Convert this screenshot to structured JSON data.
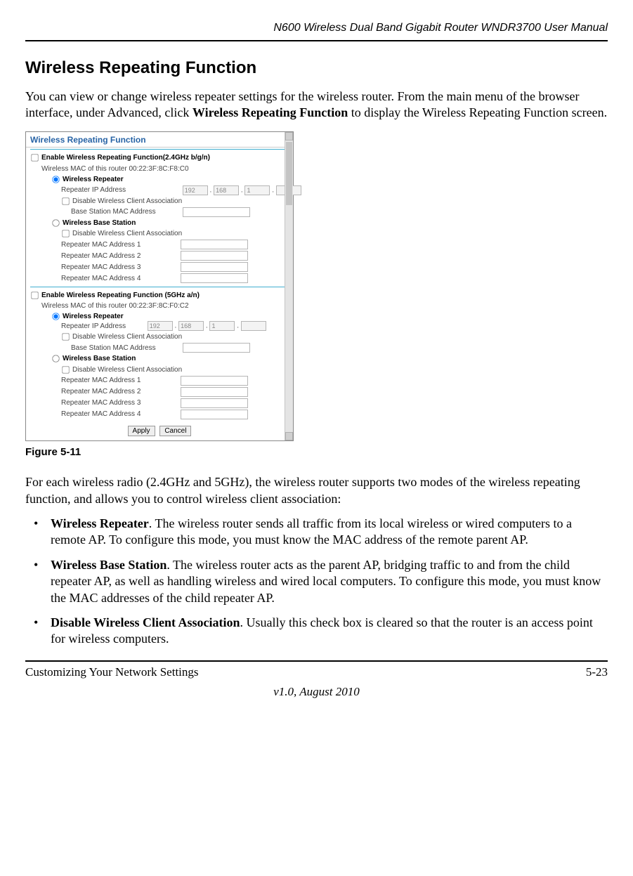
{
  "header": {
    "title": "N600 Wireless Dual Band Gigabit Router WNDR3700 User Manual"
  },
  "section": {
    "title": "Wireless Repeating Function",
    "intro_before_bold": "You can view or change wireless repeater settings for the wireless router. From the main menu of the browser interface, under Advanced, click ",
    "intro_bold": "Wireless Repeating Function",
    "intro_after_bold": " to display the Wireless Repeating Function screen."
  },
  "figure": {
    "title": "Wireless Repeating Function",
    "caption": "Figure 5-11",
    "band24": {
      "enable_label": "Enable Wireless Repeating Function(2.4GHz b/g/n)",
      "mac_label": "Wireless MAC of this router 00:22:3F:8C:F8:C0",
      "repeater_option": "Wireless Repeater",
      "repeater_ip_label": "Repeater IP Address",
      "ip": [
        "192",
        "168",
        "1",
        ""
      ],
      "disable_assoc": "Disable Wireless Client Association",
      "base_mac_label": "Base Station MAC Address",
      "base_option": "Wireless Base Station",
      "rep_mac1": "Repeater MAC Address 1",
      "rep_mac2": "Repeater MAC Address 2",
      "rep_mac3": "Repeater MAC Address 3",
      "rep_mac4": "Repeater MAC Address 4"
    },
    "band5": {
      "enable_label": "Enable Wireless Repeating Function (5GHz a/n)",
      "mac_label": "Wireless MAC of this router 00:22:3F:8C:F0:C2",
      "repeater_option": "Wireless Repeater",
      "repeater_ip_label": "Repeater IP Address",
      "ip": [
        "192",
        "168",
        "1",
        ""
      ],
      "disable_assoc": "Disable Wireless Client Association",
      "base_mac_label": "Base Station MAC Address",
      "base_option": "Wireless Base Station",
      "rep_mac1": "Repeater MAC Address 1",
      "rep_mac2": "Repeater MAC Address 2",
      "rep_mac3": "Repeater MAC Address 3",
      "rep_mac4": "Repeater MAC Address 4"
    },
    "buttons": {
      "apply": "Apply",
      "cancel": "Cancel"
    }
  },
  "body": {
    "para1": "For each wireless radio (2.4GHz and 5GHz), the wireless router supports two modes of the wireless repeating function, and allows you to control wireless client association:",
    "bullets": [
      {
        "bold": "Wireless Repeater",
        "text": ". The wireless router sends all traffic from its local wireless or wired computers to a remote AP. To configure this mode, you must know the MAC address of the remote parent AP."
      },
      {
        "bold": "Wireless Base Station",
        "text": ". The wireless router acts as the parent AP, bridging traffic to and from the child repeater AP, as well as handling wireless and wired local computers. To configure this mode, you must know the MAC addresses of the child repeater AP."
      },
      {
        "bold": "Disable Wireless Client Association",
        "text": ". Usually this check box is cleared so that the router is an access point for wireless computers."
      }
    ]
  },
  "footer": {
    "left": "Customizing Your Network Settings",
    "right": "5-23",
    "version": "v1.0, August 2010"
  }
}
